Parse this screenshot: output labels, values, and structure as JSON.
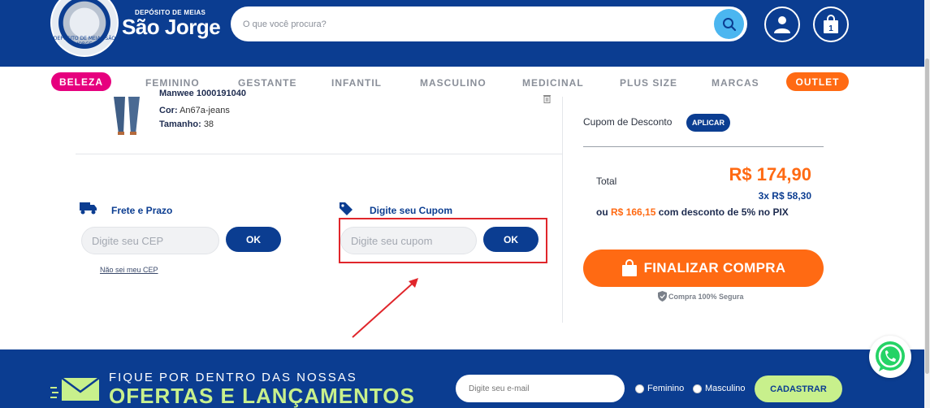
{
  "header": {
    "logo_seal_text": "DEPÓSITO DE MEIAS SÃO JORGE",
    "logo_small": "DEPÓSITO DE MEIAS",
    "logo_big": "São Jorge",
    "search_placeholder": "O que você procura?"
  },
  "nav": {
    "items": [
      "BELEZA",
      "FEMININO",
      "GESTANTE",
      "INFANTIL",
      "MASCULINO",
      "MEDICINAL",
      "PLUS SIZE",
      "MARCAS",
      "OUTLET"
    ]
  },
  "product": {
    "name_partial": "Manwee 1000191040",
    "color_label": "Cor:",
    "color_value": "An67a-jeans",
    "size_label": "Tamanho:",
    "size_value": "38"
  },
  "shipping": {
    "title": "Frete e Prazo",
    "cep_placeholder": "Digite seu CEP",
    "ok_label": "OK",
    "unknown_cep_link": "Não sei meu CEP"
  },
  "coupon": {
    "title": "Digite seu Cupom",
    "placeholder": "Digite seu cupom",
    "ok_label": "OK"
  },
  "summary": {
    "coupon_label": "Cupom de Desconto",
    "apply_label": "APLICAR",
    "total_label": "Total",
    "total_value": "R$ 174,90",
    "installments": "3x R$ 58,30",
    "pix_prefix": "ou",
    "pix_value": "R$ 166,15",
    "pix_suffix": "com desconto de 5% no PIX",
    "checkout_label": "FINALIZAR COMPRA",
    "secure_label": "Compra 100% Segura"
  },
  "newsletter": {
    "small": "FIQUE POR DENTRO DAS NOSSAS",
    "big": "OFERTAS E LANÇAMENTOS",
    "email_placeholder": "Digite seu e-mail",
    "option_female": "Feminino",
    "option_male": "Masculino",
    "subscribe_label": "CADASTRAR"
  },
  "colors": {
    "brand_blue": "#0b3d91",
    "accent_orange": "#ff6a13",
    "beleza_pink": "#e6007e",
    "newsletter_green": "#c8f08c",
    "highlight_red": "#e0262b"
  }
}
